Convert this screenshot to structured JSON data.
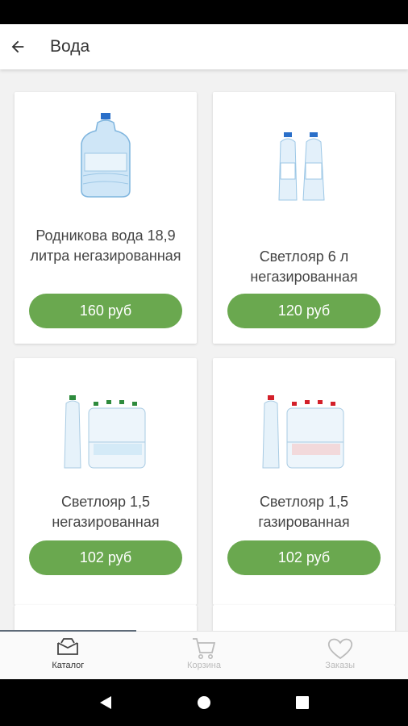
{
  "app_bar": {
    "title": "Вода",
    "back_icon": "arrow-left-icon"
  },
  "products": [
    {
      "name": "Родникова вода 18,9 литра негазированная",
      "price": "160 руб"
    },
    {
      "name": "Светлояр 6 л негазированная",
      "price": "120 руб"
    },
    {
      "name": "Светлояр 1,5 негазированная",
      "price": "102 руб"
    },
    {
      "name": "Светлояр 1,5 газированная",
      "price": "102 руб"
    }
  ],
  "bottom_nav": {
    "items": [
      {
        "label": "Каталог",
        "icon": "catalog-icon",
        "active": true
      },
      {
        "label": "Корзина",
        "icon": "cart-icon",
        "active": false
      },
      {
        "label": "Заказы",
        "icon": "heart-icon",
        "active": false
      }
    ]
  },
  "colors": {
    "accent": "#6aa84f",
    "background": "#f2f2f2"
  }
}
